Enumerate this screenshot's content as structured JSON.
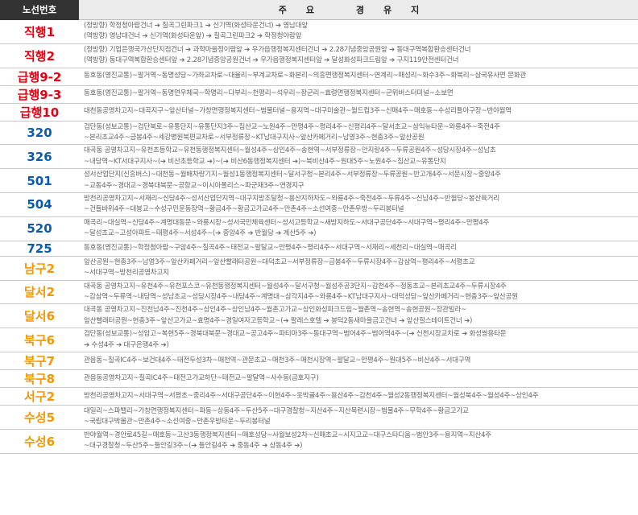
{
  "header": {
    "number_col": "노선번호",
    "route_col": "주요 경유지"
  },
  "colors": {
    "red": "#e60012",
    "blue": "#0a5bb0",
    "orange": "#f39800"
  },
  "routes": [
    {
      "num": "직행1",
      "color": "red",
      "lines": [
        "(정방향) 학정청아람건너 ➔ 칠곡그린파크1 ➔ 신기역(화성타운건너) ➔ 영남대앞",
        "(역방향) 영남대건너 ➔ 신기역(화성타운앞) ➔ 칠곡그린파크2 ➔ 학정청아람앞"
      ]
    },
    {
      "num": "직행2",
      "color": "red",
      "lines": [
        "(정방향) 기업은행국가산단지점건너 ➔ 과학마을정이람앞 ➔ 우가읍행정복지센터건너 ➔ 2.28기념중앙공원앞 ➔ 동대구역복합환승센터건너",
        "(역방향) 동대구역복합환승센터앞 ➔ 2.28기념중앙공원건너 ➔ 우가읍행정복지센터앞 ➔ 달성화성파크드림앞 ➔ 구지119안전센터건너"
      ]
    },
    {
      "num": "급행9-2",
      "color": "red",
      "lines": [
        "동호동(영진교통)~팔거역~동명성당~가좌교차로~대율리~부계교차로~화본리~의흥면행정복지센터~연계리~매성리~화수3주~화북리~삼국유사면 문화관"
      ]
    },
    {
      "num": "급행9-3",
      "color": "red",
      "lines": [
        "동호동(영진교통)~팔거역~동명면우체국~학명리~다부리~천평리~석우리~장군리~효령면행정복지센터~군위버스터미널~소보면"
      ]
    },
    {
      "num": "급행10",
      "color": "red",
      "lines": [
        "대천동공영차고지~대곡지구~앞산터널~가창면행정복지센터~범물터널~용지역~대구미술관~월드컵3주~신매4주~매호동~수성리틀아구장~반야월역"
      ]
    },
    {
      "num": "320",
      "color": "blue",
      "lines": [
        "검단동(성보교통)~검단북로~유통단지~유통단지3주~침산교~노원4주~만평4주~평리4주~신평리4주~달서초교~삼익뉴타운~와룡4주~죽전4주",
        "~본리초교4주~금봉4주~세강병원북편교차로~서부정류장~KT남대구지사~앞산카페거리~남영3주~현충3주~앞산공원"
      ]
    },
    {
      "num": "326",
      "color": "blue",
      "lines": [
        "대곡동 공영차고지~유천초등학교~유천동행정복지센터~월성4주~상인4주~송현역~서부정류장~안지랑4주~두류공원4주~성당시장4주~성남초",
        "~내당역~KT서대구지사~(➔ 비산초등학교 ➔)~(➔ 비산6동행정복지센터 ➔)~북비산4주~원대5주~노원4주~침산교~유통단지"
      ]
    },
    {
      "num": "501",
      "color": "blue",
      "lines": [
        "성서산업단지(신흥버스)~대천동~월배차량기지~월성1동행정복지센터~달서구청~본리4주~서부정류장~두류공원~반고개4주~서문시장~중앙4주",
        "~교동4주~경대교~경북대북문~공항교~이시아폴리스~파군재3주~연경지구"
      ]
    },
    {
      "num": "504",
      "color": "blue",
      "lines": [
        "방천리공영차고지~서재리~신당4주~성서산업단지역~대구지방조달청~용산지하차도~와룡4주~죽전4주~두류4주~신남4주~반월당~봉산육거리",
        "~건들바위4주~대봉교~수성구민운동장역~황금4주~황금고가교4주~만촌4주~소선여중~만촌우방~두리봉터널"
      ]
    },
    {
      "num": "520",
      "color": "blue",
      "lines": [
        "매곡리~대실역~신당4주~계명대동문~와룡시장~성서국민체육센터~성서고등학교~새방지하도~서대구공단4주~서대구역~평리4주~만평4주",
        "~달성초교~고성아파트~태평4주~서성4주~(➔ 중앙4주 ➔ 반월당 ➔ 계산5주 ➔)"
      ]
    },
    {
      "num": "725",
      "color": "blue",
      "lines": [
        "동호동(영진교통)~학정청아람~구암4주~칠곡4주~태전교~팔달교~만평4주~평리4주~서대구역~서재리~세천리~대실역~매곡리"
      ]
    },
    {
      "num": "남구2",
      "color": "orange",
      "lines": [
        "앞산공원~현충3주~남영3주~앞산카페거리~앞산빨래터공원~대덕초교~서부정류장~금봉4주~두류시장4주~감삼역~평리4주~서평초교",
        "~서대구역~방천리공영차고지"
      ]
    },
    {
      "num": "달서2",
      "color": "orange",
      "lines": [
        "대곡동 공영차고지~유천4주~유천포스코~유천동행정복지센터~월성4주~달서구청~월성주공3단지~감천4주~정동초교~본리초교4주~두류시장4주",
        "~감삼역~두류역~내당역~성남초교~성당시장4주~내당4주~계명대~삼각지4주~와룡4주~KT남대구지사~대덕성당~앞산카페거리~현충3주~앞산공원"
      ]
    },
    {
      "num": "달서6",
      "color": "orange",
      "lines": [
        "대곡동 공영차고지~진천남4주~진천4주~상인4주~상인남4주~월촌고가교~상인화성파크드림~월촌역~송현역~송현공원~장관빌라~",
        "앞산빨래터공원~현충3주~앞산고가교~효명4주~경일여자고등학교~(➔ 팔레스호텔 ➔ 봉덕2동새마을금고건너 ➔ 앞산힐스테이트건너 ➔)"
      ]
    },
    {
      "num": "북구6",
      "color": "orange",
      "lines": [
        "검단동(성보교통)~성암고~복현5주~경북대북문~경대교~공고4주~파티마3주~동대구역~범어4주~범어역4주~(➔ 신천시장교차로 ➔ 화성쌍용타운",
        "➔ 수성4주 ➔ 대구은행4주 ➔)"
      ]
    },
    {
      "num": "북구7",
      "color": "orange",
      "lines": [
        "관음동~칠곡IC4주~보건대4주~태전두성3차~매천역~관문초교~매천3주~매천시장역~팔달교~만평4주~원대5주~비산4주~서대구역"
      ]
    },
    {
      "num": "북구8",
      "color": "orange",
      "lines": [
        "관음동공영차고지~칠곡IC4주~태전고가교하단~태전교~팔달역~사수동(금호지구)"
      ]
    },
    {
      "num": "서구2",
      "color": "orange",
      "lines": [
        "방천리공영차고지~서대구역~서평초~중리4주~서대구공단4주~이현4주~옷박골4주~용산4주~감천4주~월성2동행정복지센터~월성북4주~월성4주~상인4주"
      ]
    },
    {
      "num": "수성5",
      "color": "orange",
      "lines": [
        "대일리~스파밸리~가창면행정복지센터~파동~상동4주~두산5주~대구경찰청~지산4주~지산목련시장~범물4주~무학4주~황금고가교",
        "~국립대구박물관~만촌4주~소선여중~만촌우방타운~두리봉터널"
      ]
    },
    {
      "num": "수성6",
      "color": "orange",
      "lines": [
        "반야월역~경안로45길~매호동~고산3동행정복지센터~매호성당~사월보성2차~신매초교~시지고교~대구스타디움~범안3주~용지역~지산4주",
        "~대구경찰청~두산5주~들안길3주~(➔ 들안길4주 ➔ 중동4주 ➔ 상동4주 ➔)"
      ]
    }
  ]
}
